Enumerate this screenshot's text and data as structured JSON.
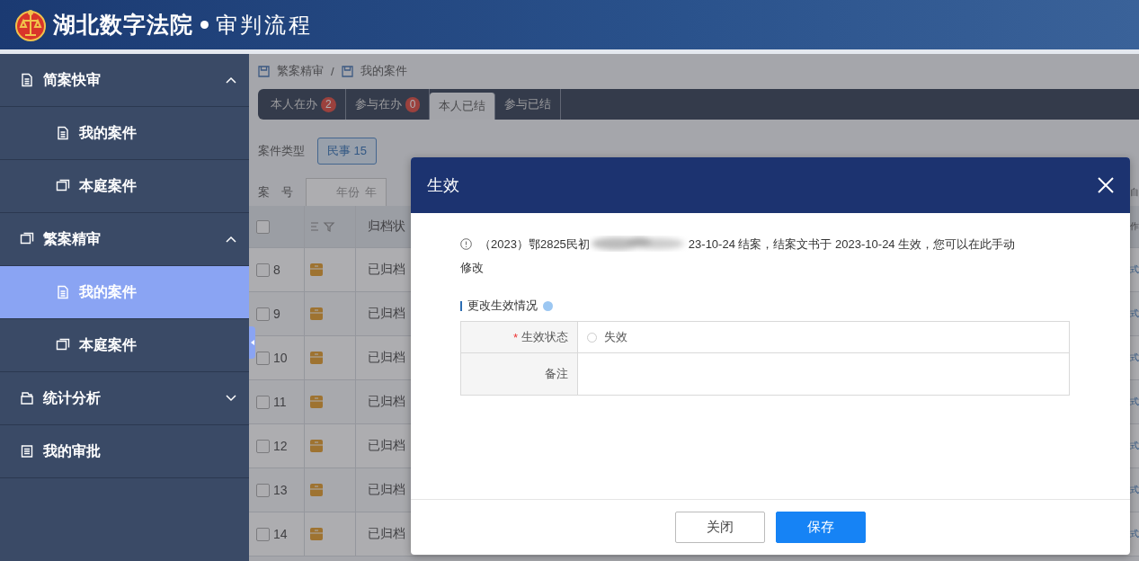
{
  "header": {
    "title": "湖北数字法院",
    "subtitle": "审判流程"
  },
  "sidebar": {
    "items": [
      {
        "label": "简案快审",
        "expanded": true,
        "selected": false,
        "children": [
          {
            "label": "我的案件",
            "selected": false
          },
          {
            "label": "本庭案件",
            "selected": false
          }
        ]
      },
      {
        "label": "繁案精审",
        "expanded": true,
        "selected": false,
        "children": [
          {
            "label": "我的案件",
            "selected": true
          },
          {
            "label": "本庭案件",
            "selected": false
          }
        ]
      },
      {
        "label": "统计分析",
        "expanded": false,
        "selected": false
      },
      {
        "label": "我的审批",
        "selected": false
      }
    ]
  },
  "breadcrumb": [
    "繁案精审",
    "我的案件"
  ],
  "breadcrumb_separator": "/",
  "tabs": [
    {
      "label": "本人在办",
      "count": "2",
      "selected": false
    },
    {
      "label": "参与在办",
      "count": "0",
      "selected": false
    },
    {
      "label": "本人已结",
      "selected": true
    },
    {
      "label": "参与已结",
      "selected": false
    }
  ],
  "filters": {
    "case_type_label": "案件类型",
    "case_type_chip": "民事 15",
    "case_no_label": "案　号",
    "year_placeholder": "年份",
    "year_suffix": "年",
    "column_edge": "自"
  },
  "table": {
    "columns": [
      "归档状"
    ],
    "select_all_checked": false,
    "edge_header": "作",
    "rows": [
      {
        "no": "8",
        "checked": false,
        "status": "已归档",
        "edge": "式"
      },
      {
        "no": "9",
        "checked": false,
        "status": "已归档",
        "edge": "式"
      },
      {
        "no": "10",
        "checked": false,
        "status": "已归档",
        "edge": "式"
      },
      {
        "no": "11",
        "checked": false,
        "status": "已归档",
        "edge": "式"
      },
      {
        "no": "12",
        "checked": false,
        "status": "已归档",
        "edge": "式"
      },
      {
        "no": "13",
        "checked": false,
        "status": "已归档",
        "edge": "式"
      },
      {
        "no": "14",
        "checked": false,
        "status": "已归档",
        "edge": "式"
      }
    ]
  },
  "dialog": {
    "title": "生效",
    "message_start": "（2023）鄂2825民初",
    "message_end": "23-10-24 结案，结案文书于 2023-10-24 生效，您可以在此手动",
    "message_continued": "修改",
    "section": "更改生效情况",
    "form": [
      {
        "kind": "radio",
        "label": "生效状态",
        "required_mark": "*",
        "option": "失效",
        "checked": false
      },
      {
        "kind": "text",
        "label": "备注"
      }
    ],
    "buttons": [
      {
        "label": "关闭",
        "primary": false
      },
      {
        "label": "保存",
        "primary": true
      }
    ]
  }
}
